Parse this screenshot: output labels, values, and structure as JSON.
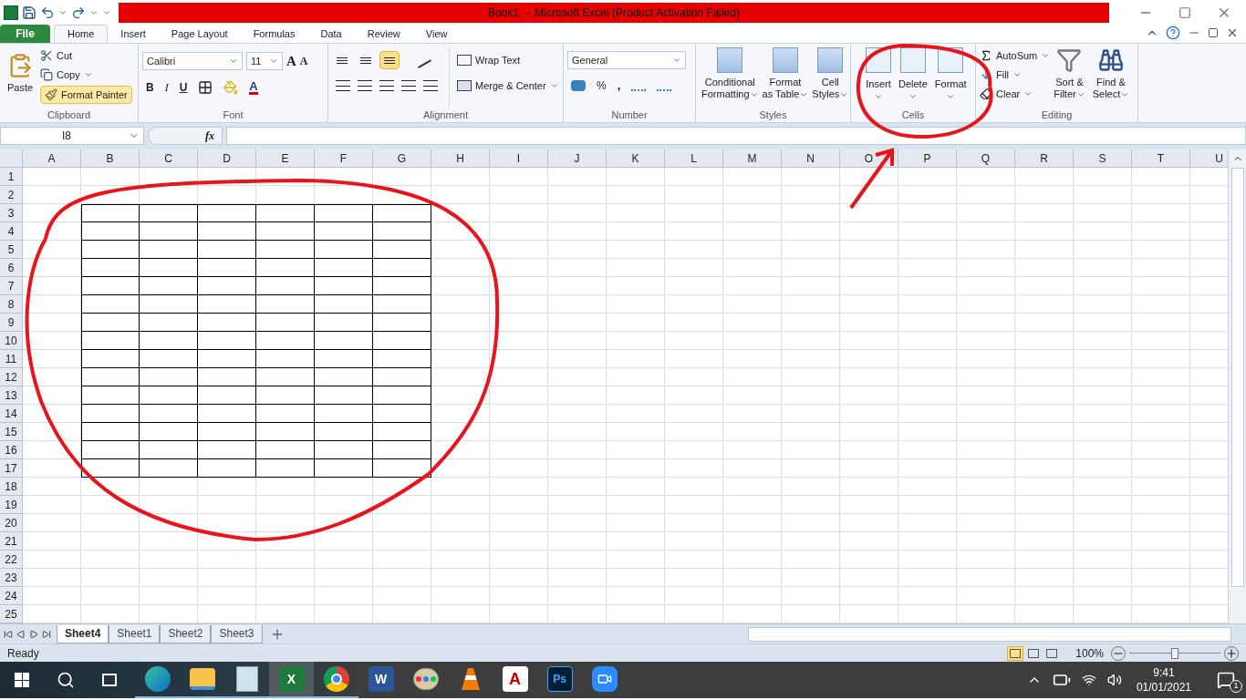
{
  "title_bar": {
    "title": "Book1  -  Microsoft Excel (Product Activation Failed)"
  },
  "ribbon_tabs": [
    {
      "label": "File",
      "kind": "file",
      "selected": false
    },
    {
      "label": "Home",
      "kind": "tab",
      "selected": true
    },
    {
      "label": "Insert",
      "kind": "tab",
      "selected": false
    },
    {
      "label": "Page Layout",
      "kind": "tab",
      "selected": false
    },
    {
      "label": "Formulas",
      "kind": "tab",
      "selected": false
    },
    {
      "label": "Data",
      "kind": "tab",
      "selected": false
    },
    {
      "label": "Review",
      "kind": "tab",
      "selected": false
    },
    {
      "label": "View",
      "kind": "tab",
      "selected": false
    }
  ],
  "clipboard": {
    "label": "Clipboard",
    "paste": "Paste",
    "cut": "Cut",
    "copy": "Copy",
    "format_painter": {
      "label": "Format Painter",
      "on": true
    }
  },
  "font": {
    "label": "Font",
    "name": "Calibri",
    "size": "11",
    "grow": "A",
    "shrink": "A",
    "bold": "B",
    "italic": "I",
    "underline": "U",
    "font_color": "A"
  },
  "alignment": {
    "label": "Alignment",
    "wrap_text": "Wrap Text",
    "merge_center": "Merge & Center",
    "vertical": [
      {
        "selected": false
      },
      {
        "selected": false
      },
      {
        "selected": true
      }
    ]
  },
  "number": {
    "label": "Number",
    "format": "General",
    "percent": "%",
    "comma": ","
  },
  "styles": {
    "label": "Styles",
    "buttons": [
      {
        "lines": [
          "Conditional",
          "Formatting"
        ]
      },
      {
        "lines": [
          "Format",
          "as Table"
        ]
      },
      {
        "lines": [
          "Cell",
          "Styles"
        ]
      }
    ]
  },
  "cells": {
    "label": "Cells",
    "buttons": [
      "Insert",
      "Delete",
      "Format"
    ]
  },
  "editing": {
    "label": "Editing",
    "autosum": "AutoSum",
    "fill": "Fill",
    "clear": "Clear",
    "sort": [
      "Sort &",
      "Filter"
    ],
    "find": [
      "Find &",
      "Select"
    ]
  },
  "formula_bar": {
    "name_box": "I8",
    "fx": "fx"
  },
  "sheet": {
    "columns": [
      {
        "label": "A",
        "bordered": false
      },
      {
        "label": "B",
        "bordered": true
      },
      {
        "label": "C",
        "bordered": true
      },
      {
        "label": "D",
        "bordered": true
      },
      {
        "label": "E",
        "bordered": true
      },
      {
        "label": "F",
        "bordered": true
      },
      {
        "label": "G",
        "bordered": true
      },
      {
        "label": "H",
        "bordered": false
      },
      {
        "label": "I",
        "bordered": false
      },
      {
        "label": "J",
        "bordered": false
      },
      {
        "label": "K",
        "bordered": false
      },
      {
        "label": "L",
        "bordered": false
      },
      {
        "label": "M",
        "bordered": false
      },
      {
        "label": "N",
        "bordered": false
      },
      {
        "label": "O",
        "bordered": false
      },
      {
        "label": "P",
        "bordered": false
      },
      {
        "label": "Q",
        "bordered": false
      },
      {
        "label": "R",
        "bordered": false
      },
      {
        "label": "S",
        "bordered": false
      },
      {
        "label": "T",
        "bordered": false
      },
      {
        "label": "U",
        "bordered": false
      }
    ],
    "rows": [
      {
        "label": "1",
        "bordered": false
      },
      {
        "label": "2",
        "bordered": false
      },
      {
        "label": "3",
        "bordered": true
      },
      {
        "label": "4",
        "bordered": true
      },
      {
        "label": "5",
        "bordered": true
      },
      {
        "label": "6",
        "bordered": true
      },
      {
        "label": "7",
        "bordered": true
      },
      {
        "label": "8",
        "bordered": true
      },
      {
        "label": "9",
        "bordered": true
      },
      {
        "label": "10",
        "bordered": true
      },
      {
        "label": "11",
        "bordered": true
      },
      {
        "label": "12",
        "bordered": true
      },
      {
        "label": "13",
        "bordered": true
      },
      {
        "label": "14",
        "bordered": true
      },
      {
        "label": "15",
        "bordered": true
      },
      {
        "label": "16",
        "bordered": true
      },
      {
        "label": "17",
        "bordered": true
      },
      {
        "label": "18",
        "bordered": false
      },
      {
        "label": "19",
        "bordered": false
      },
      {
        "label": "20",
        "bordered": false
      },
      {
        "label": "21",
        "bordered": false
      },
      {
        "label": "22",
        "bordered": false
      },
      {
        "label": "23",
        "bordered": false
      },
      {
        "label": "24",
        "bordered": false
      },
      {
        "label": "25",
        "bordered": false
      }
    ]
  },
  "sheet_tabs": [
    {
      "label": "Sheet4",
      "selected": true
    },
    {
      "label": "Sheet1",
      "selected": false
    },
    {
      "label": "Sheet2",
      "selected": false
    },
    {
      "label": "Sheet3",
      "selected": false
    }
  ],
  "status_bar": {
    "status": "Ready",
    "views": [
      {
        "selected": true
      },
      {
        "selected": false
      },
      {
        "selected": false
      }
    ],
    "zoom": "100%",
    "zoom_slider": {
      "level": 0.5
    }
  },
  "taskbar": {
    "apps": [
      {
        "kind": "edge",
        "running": true,
        "active": false
      },
      {
        "kind": "explorer",
        "running": true,
        "active": false
      },
      {
        "kind": "notepad",
        "running": true,
        "active": false
      },
      {
        "kind": "excel",
        "glyph": "X",
        "running": true,
        "active": true
      },
      {
        "kind": "chrome",
        "running": true,
        "active": false
      },
      {
        "kind": "word",
        "glyph": "W",
        "running": false,
        "active": false
      },
      {
        "kind": "paint",
        "running": false,
        "active": false
      },
      {
        "kind": "vlc",
        "running": false,
        "active": false
      },
      {
        "kind": "acrobat",
        "glyph": "A",
        "running": false,
        "active": false
      },
      {
        "kind": "photoshop",
        "glyph": "Ps",
        "running": false,
        "active": false
      },
      {
        "kind": "zoom",
        "running": false,
        "active": false
      }
    ],
    "time": "9:41",
    "date": "01/01/2021",
    "notifications": "1"
  }
}
